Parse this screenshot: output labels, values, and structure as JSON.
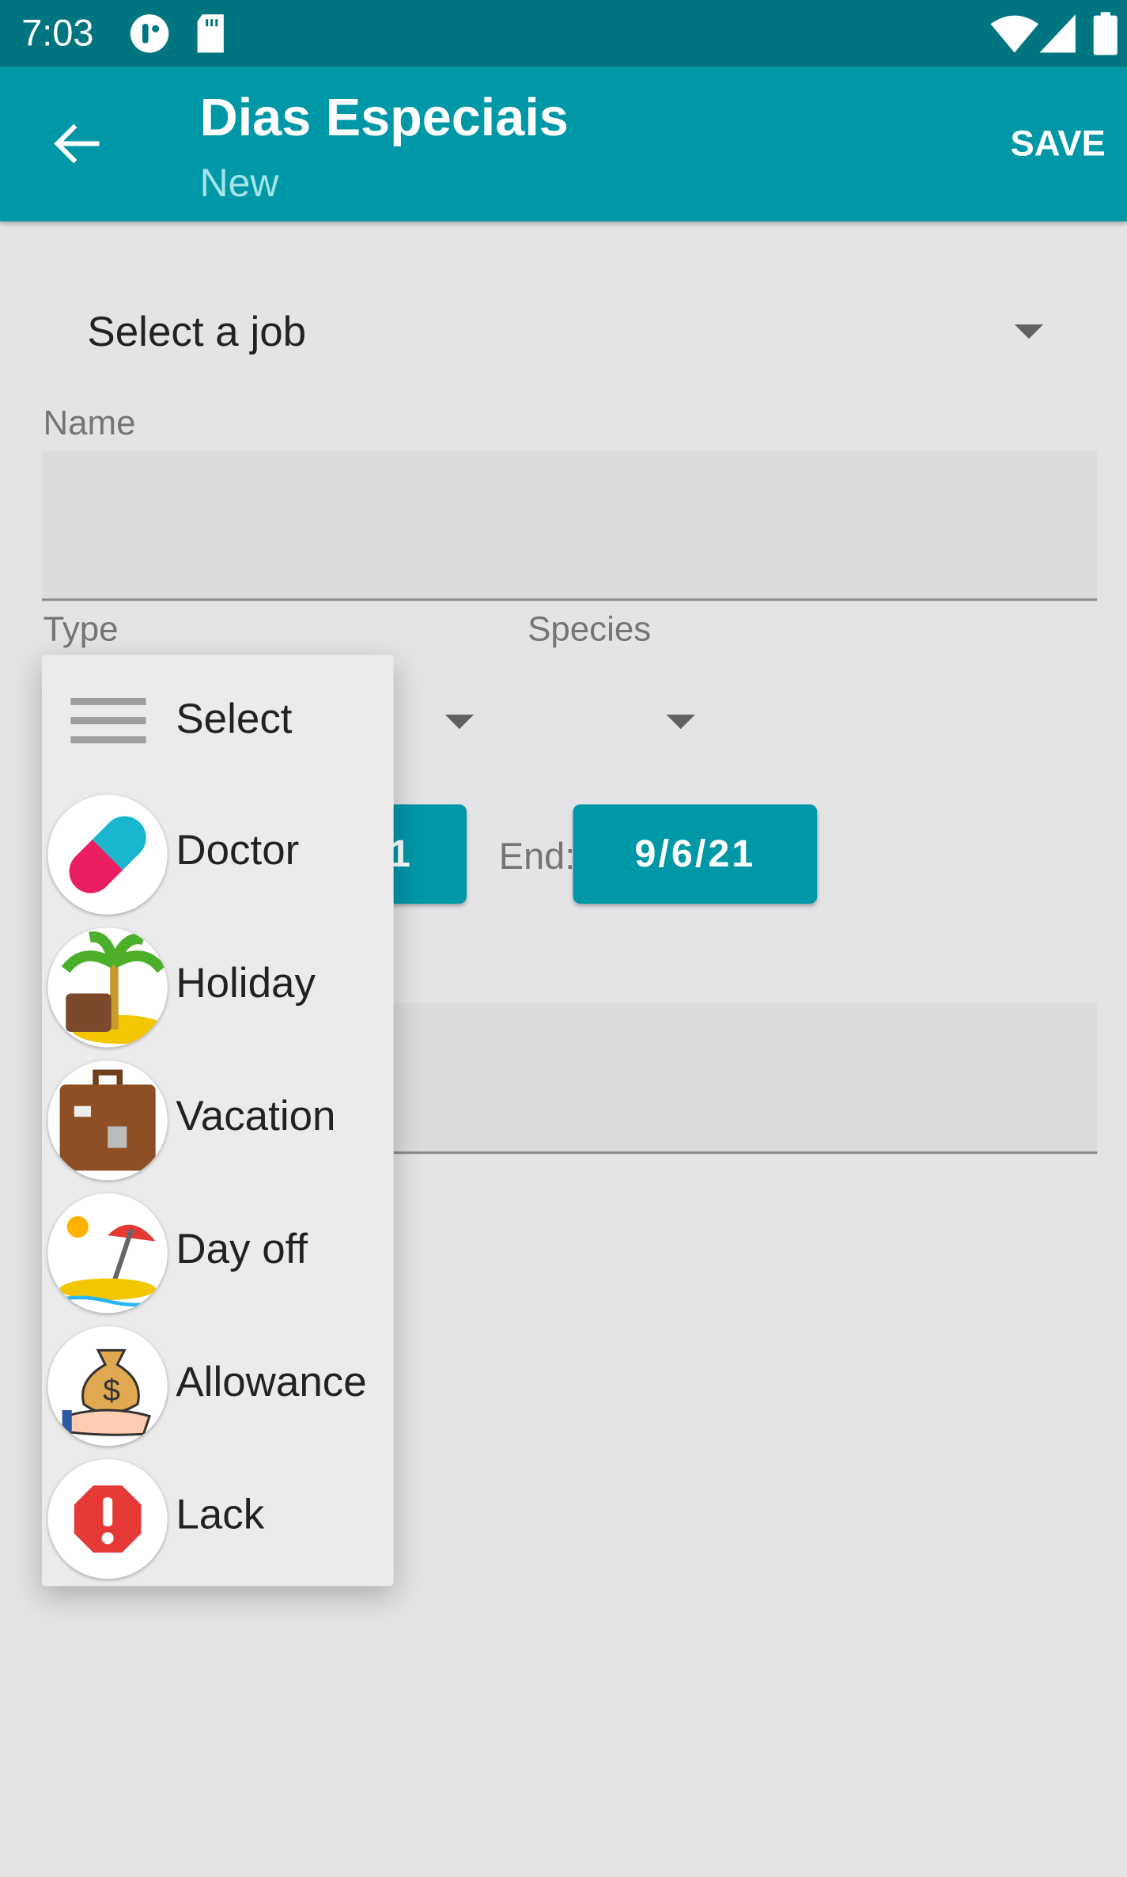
{
  "status_bar": {
    "time": "7:03",
    "icons": [
      "app-notification-icon",
      "sd-card-icon",
      "wifi-icon",
      "signal-icon",
      "battery-icon"
    ]
  },
  "app_bar": {
    "title": "Dias Especiais",
    "subtitle": "New",
    "save_label": "SAVE",
    "back_icon": "arrow-left-icon"
  },
  "form": {
    "job_select": "Select a job",
    "name_label": "Name",
    "name_value": "",
    "type_label": "Type",
    "species_label": "Species",
    "start_date_partial": "1",
    "end_label": "End:",
    "end_date": "9/6/21"
  },
  "type_menu": {
    "items": [
      {
        "label": "Select",
        "icon": "menu-lines-icon"
      },
      {
        "label": "Doctor",
        "icon": "pill-icon"
      },
      {
        "label": "Holiday",
        "icon": "palm-tree-suitcase-icon"
      },
      {
        "label": "Vacation",
        "icon": "suitcase-icon"
      },
      {
        "label": "Day off",
        "icon": "beach-umbrella-icon"
      },
      {
        "label": "Allowance",
        "icon": "money-bag-hand-icon"
      },
      {
        "label": "Lack",
        "icon": "warning-octagon-icon"
      }
    ]
  },
  "colors": {
    "primary": "#0097a7",
    "status_bar": "#007580",
    "background": "#e4e4e6"
  }
}
